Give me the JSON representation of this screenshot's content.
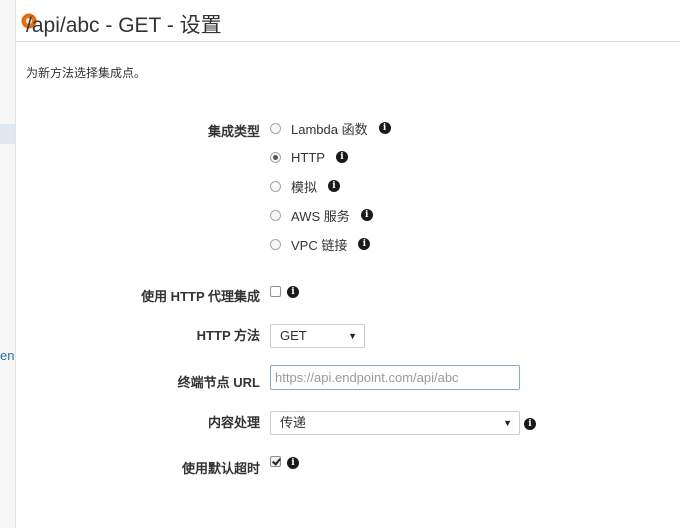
{
  "sidebar": {
    "partial_text": "en"
  },
  "header": {
    "title": "/api/abc - GET - 设置"
  },
  "intro": "为新方法选择集成点。",
  "integration_type": {
    "label": "集成类型",
    "options": [
      {
        "label": "Lambda 函数",
        "checked": false
      },
      {
        "label": "HTTP",
        "checked": true
      },
      {
        "label": "模拟",
        "checked": false
      },
      {
        "label": "AWS 服务",
        "checked": false
      },
      {
        "label": "VPC 链接",
        "checked": false
      }
    ]
  },
  "use_proxy": {
    "label": "使用 HTTP 代理集成",
    "checked": false
  },
  "http_method": {
    "label": "HTTP 方法",
    "value": "GET"
  },
  "endpoint_url": {
    "label": "终端节点 URL",
    "placeholder": "https://api.endpoint.com/api/abc",
    "value": ""
  },
  "content_handling": {
    "label": "内容处理",
    "value": "传递"
  },
  "default_timeout": {
    "label": "使用默认超时",
    "checked": true
  },
  "icons": {
    "info": "info-icon",
    "radio": "radio-button",
    "dropdown": "chevron-down-icon"
  }
}
